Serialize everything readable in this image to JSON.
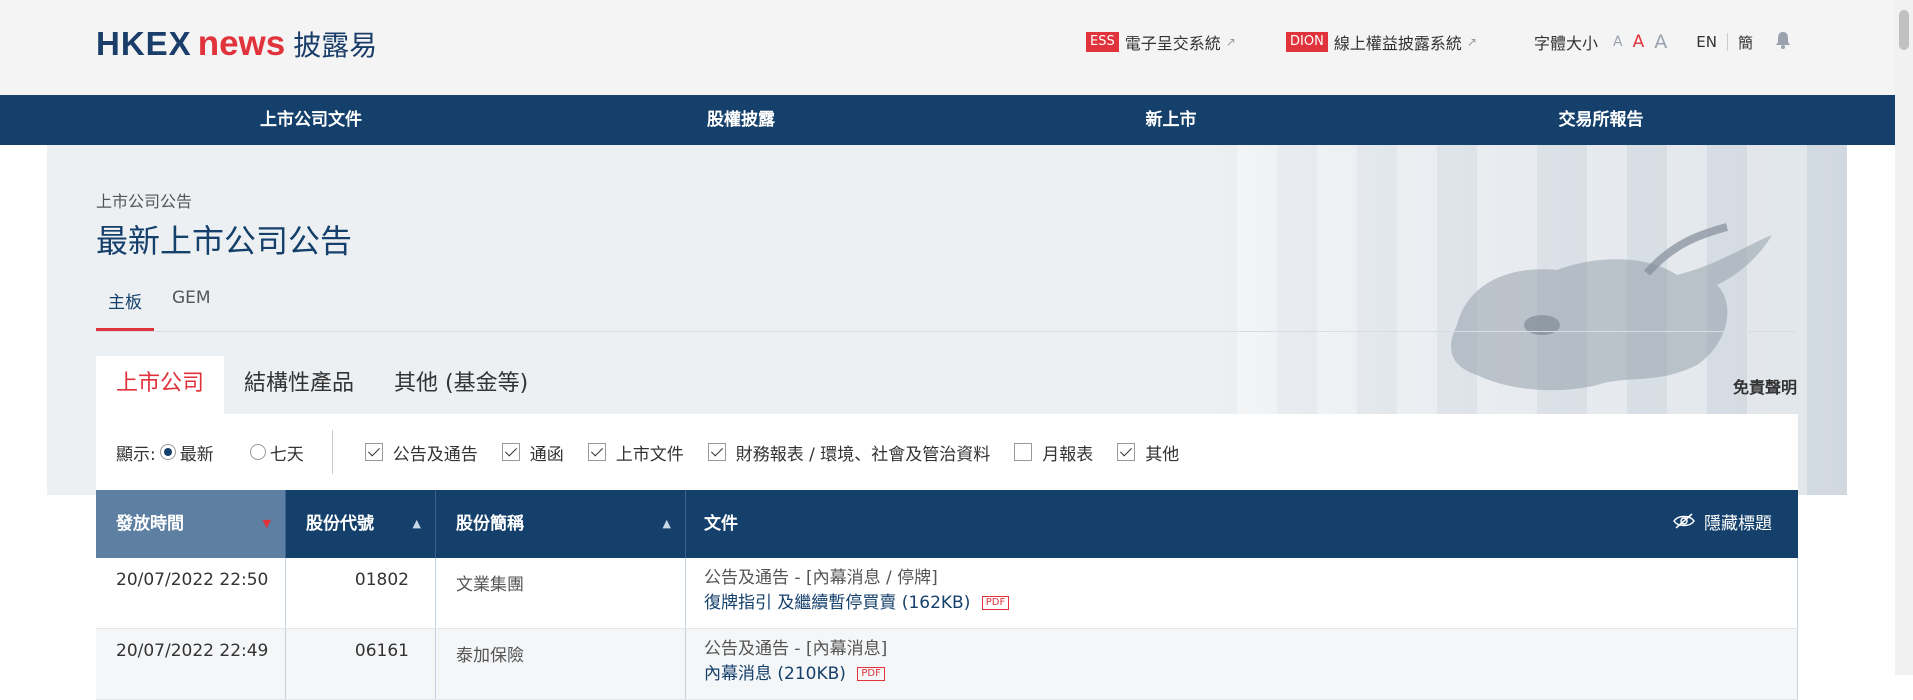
{
  "header": {
    "logo_hkex": "HKEX",
    "logo_news": "news",
    "logo_cn": "披露易",
    "ess_tag": "ESS",
    "ess_label": "電子呈交系統",
    "dion_tag": "DION",
    "dion_label": "線上權益披露系統",
    "font_size_label": "字體大小",
    "font_small": "A",
    "font_medium": "A",
    "font_large": "A",
    "lang_en": "EN",
    "lang_sc": "簡"
  },
  "nav": {
    "items": [
      "上市公司文件",
      "股權披露",
      "新上市",
      "交易所報告"
    ]
  },
  "page": {
    "breadcrumb": "上市公司公告",
    "title": "最新上市公司公告",
    "board_tabs": [
      "主板",
      "GEM"
    ],
    "category_tabs": [
      "上市公司",
      "結構性產品",
      "其他 (基金等)"
    ],
    "disclaimer": "免責聲明"
  },
  "filters": {
    "show_label": "顯示:",
    "radio_latest": "最新",
    "radio_7days": "七天",
    "checkboxes": [
      "公告及通告",
      "通函",
      "上市文件",
      "財務報表 / 環境、社會及管治資料",
      "月報表",
      "其他"
    ]
  },
  "table": {
    "headers": [
      "發放時間",
      "股份代號",
      "股份簡稱",
      "文件"
    ],
    "hide_titles": "隱藏標題",
    "rows": [
      {
        "time": "20/07/2022 22:50",
        "code": "01802",
        "name": "文業集團",
        "category": "公告及通告 - [內幕消息 / 停牌]",
        "doc": "復牌指引 及繼續暫停買賣 (162KB)",
        "badge": "PDF"
      },
      {
        "time": "20/07/2022 22:49",
        "code": "06161",
        "name": "泰加保險",
        "category": "公告及通告 - [內幕消息]",
        "doc": "內幕消息 (210KB)",
        "badge": "PDF"
      }
    ]
  }
}
